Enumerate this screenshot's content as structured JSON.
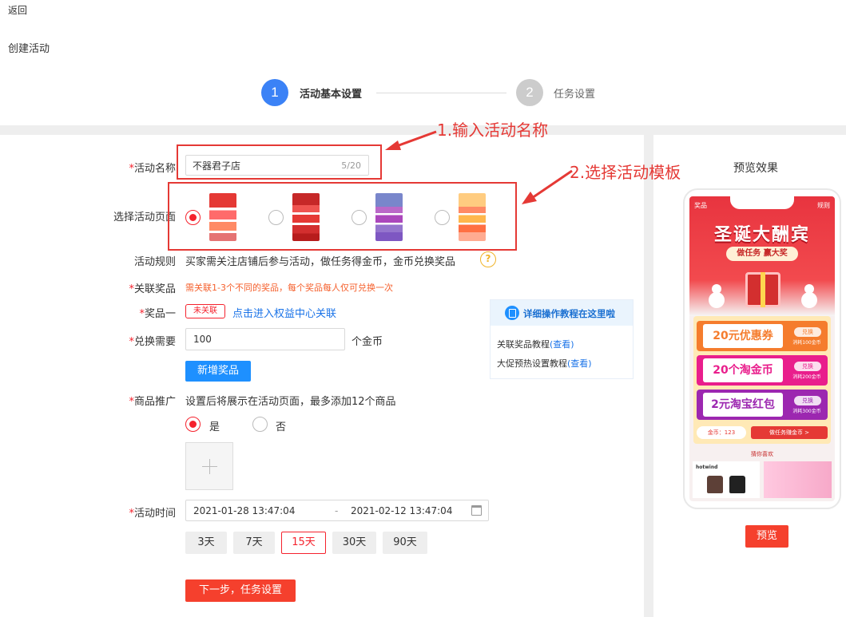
{
  "header": {
    "back_label": "返回",
    "page_title": "创建活动"
  },
  "steps": [
    {
      "number": "1",
      "label": "活动基本设置",
      "active": true
    },
    {
      "number": "2",
      "label": "任务设置",
      "active": false
    }
  ],
  "annotations": {
    "a1": "1.输入活动名称",
    "a2": "2.选择活动模板",
    "color": "#e53935"
  },
  "form": {
    "required_mark": "*",
    "name": {
      "label": "活动名称",
      "value": "不器君子店",
      "count": "5/20"
    },
    "template": {
      "label": "选择活动页面",
      "options": [
        {
          "selected": true,
          "name": "圣诞大酬宾"
        },
        {
          "selected": false,
          "name": ""
        },
        {
          "selected": false,
          "name": ""
        },
        {
          "selected": false,
          "name": ""
        }
      ]
    },
    "rule": {
      "label": "活动规则",
      "text": "买家需关注店铺后参与活动，做任务得金币，金币兑换奖品",
      "help": "?"
    },
    "prize_link": {
      "label": "关联奖品",
      "hint": "需关联1-3个不同的奖品，每个奖品每人仅可兑换一次"
    },
    "prize_one": {
      "label": "奖品一",
      "tag": "未关联",
      "link": "点击进入权益中心关联"
    },
    "exchange": {
      "label": "兑换需要",
      "value": "100",
      "unit": "个金币"
    },
    "add_prize_button": "新增奖品",
    "promo": {
      "label": "商品推广",
      "desc": "设置后将展示在活动页面，最多添加12个商品",
      "yes": "是",
      "no": "否",
      "selected": "yes"
    },
    "time": {
      "label": "活动时间",
      "start": "2021-01-28 13:47:04",
      "separator": "-",
      "end": "2021-02-12 13:47:04",
      "quick_options": [
        "3天",
        "7天",
        "15天",
        "30天",
        "90天"
      ],
      "active_option": "15天"
    },
    "next_button": "下一步，任务设置"
  },
  "tutorial": {
    "title": "详细操作教程在这里啦",
    "items": [
      {
        "text": "关联奖品教程",
        "link": "(查看)"
      },
      {
        "text": "大促预热设置教程",
        "link": "(查看)"
      }
    ]
  },
  "preview": {
    "title": "预览效果",
    "phone": {
      "top_left": "奖品",
      "top_right": "规则",
      "headline": "圣诞大酬宾",
      "subline": "做任务 赢大奖",
      "coupons": [
        {
          "text": "20元优惠券",
          "btn": "兑换",
          "cost": "消耗100金币",
          "color": "#f57c2d",
          "text_color": "#f57c2d"
        },
        {
          "text": "20个淘金币",
          "btn": "兑换",
          "cost": "消耗200金币",
          "color": "#e91e8c",
          "text_color": "#e91e8c"
        },
        {
          "text": "2元淘宝红包",
          "btn": "兑换",
          "cost": "消耗300金币",
          "color": "#9c27b0",
          "text_color": "#9c27b0"
        }
      ],
      "coin_text": "金币：123",
      "earn_text": "做任务赚金币 >",
      "guess_title": "猜你喜欢",
      "product_brand": "hotwind"
    },
    "button": "预览"
  },
  "colors": {
    "primary_blue": "#3b82f6",
    "accent_red": "#f5402d",
    "link_blue": "#1a73e8"
  }
}
